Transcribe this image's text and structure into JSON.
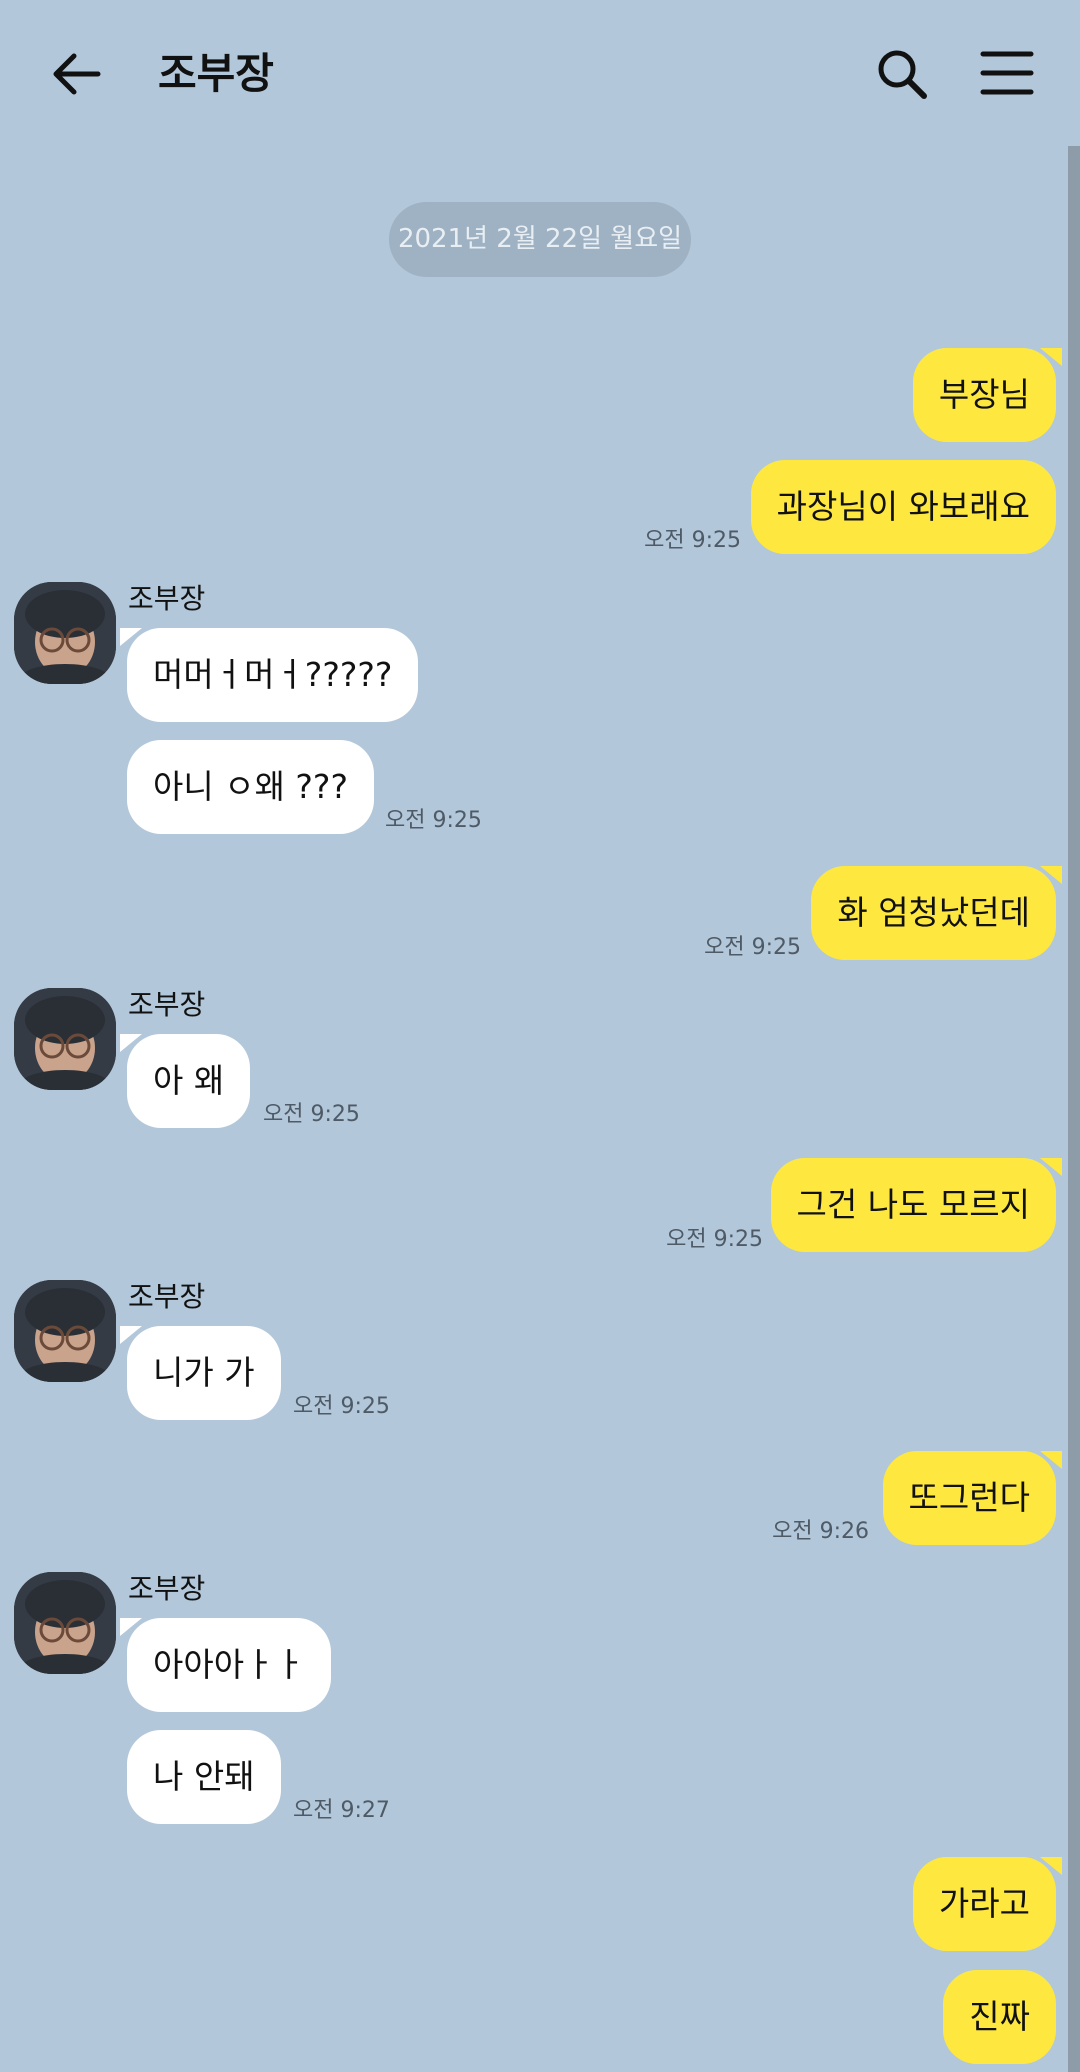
{
  "header": {
    "title": "조부장",
    "back_icon": "arrow-left-icon",
    "search_icon": "search-icon",
    "menu_icon": "hamburger-menu-icon"
  },
  "date_divider": "2021년 2월 22일 월요일",
  "sender_name": "조부장",
  "messages": [
    {
      "text": "부장님"
    },
    {
      "text": "과장님이 와보래요",
      "time": "오전 9:25"
    },
    {
      "text": "머머ㅓ머ㅓ?????"
    },
    {
      "text": "아니 ㅇ왜 ???",
      "time": "오전 9:25"
    },
    {
      "text": "화 엄청났던데",
      "time": "오전 9:25"
    },
    {
      "text": "아 왜",
      "time": "오전 9:25"
    },
    {
      "text": "그건 나도 모르지",
      "time": "오전 9:25"
    },
    {
      "text": "니가 가",
      "time": "오전 9:25"
    },
    {
      "text": "또그런다",
      "time": "오전 9:26"
    },
    {
      "text": "아아아ㅏㅏ"
    },
    {
      "text": "나 안돼",
      "time": "오전 9:27"
    },
    {
      "text": "가라고"
    },
    {
      "text": "진짜"
    }
  ],
  "colors": {
    "background": "#b2c7da",
    "my_bubble": "#fee83f",
    "other_bubble": "#ffffff"
  }
}
